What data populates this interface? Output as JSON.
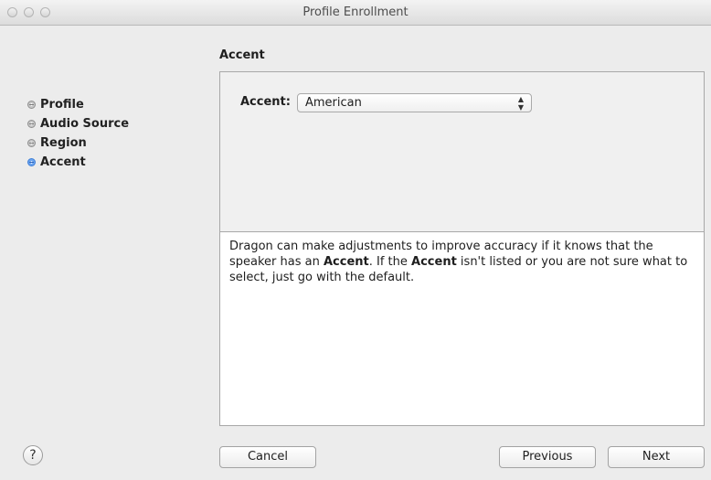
{
  "window": {
    "title": "Profile Enrollment"
  },
  "section": {
    "title": "Accent"
  },
  "steps": [
    {
      "label": "Profile",
      "active": false
    },
    {
      "label": "Audio Source",
      "active": false
    },
    {
      "label": "Region",
      "active": false
    },
    {
      "label": "Accent",
      "active": true
    }
  ],
  "accent": {
    "label": "Accent:",
    "selected": "American"
  },
  "description": {
    "part1": "Dragon can make adjustments to improve accuracy if it knows that the speaker has an ",
    "bold1": "Accent",
    "part2": ". If the ",
    "bold2": "Accent",
    "part3": " isn't listed or you are not sure what to select, just go with the default."
  },
  "buttons": {
    "help": "?",
    "cancel": "Cancel",
    "previous": "Previous",
    "next": "Next"
  }
}
